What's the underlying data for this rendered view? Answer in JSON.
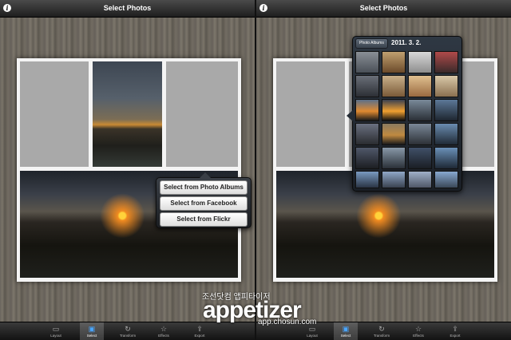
{
  "title": "Select Photos",
  "popover_menu": {
    "items": [
      "Select from Photo Albums",
      "Select from Facebook",
      "Select from Flickr"
    ]
  },
  "photo_picker": {
    "back_label": "Photo Albums",
    "album_title": "2011. 3. 2."
  },
  "tabs": [
    {
      "label": "Layout",
      "icon": "layout-icon"
    },
    {
      "label": "Select",
      "icon": "select-icon"
    },
    {
      "label": "Transform",
      "icon": "transform-icon"
    },
    {
      "label": "Effects",
      "icon": "effects-icon"
    },
    {
      "label": "Export",
      "icon": "export-icon"
    }
  ],
  "active_tab": "Select",
  "watermark": {
    "korean": "조선닷컴 앱피타이저",
    "logo": "appetizer",
    "url": "app.chosun.com"
  },
  "colors": {
    "accent": "#49a6ff",
    "title_bar": "#2a2a2a"
  }
}
